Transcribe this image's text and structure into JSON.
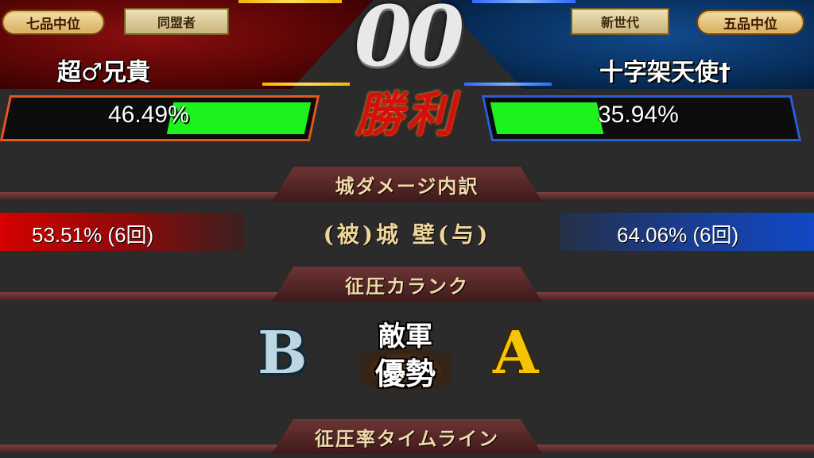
{
  "score": "00",
  "result": "勝利",
  "left": {
    "rank_badge": "七品中位",
    "guild_badge": "同盟者",
    "name": "超♂兄貴",
    "hp_percent": "46.49%",
    "hp_fill_fraction": 0.4649,
    "wall_damage": "53.51% (6回)",
    "color": "#d40000"
  },
  "right": {
    "rank_badge": "五品中位",
    "guild_badge": "新世代",
    "name": "十字架天使†",
    "hp_percent": "35.94%",
    "hp_fill_fraction": 0.3594,
    "wall_damage": "64.06% (6回)",
    "color": "#1248c6"
  },
  "sections": {
    "wall_damage_header": "城ダメージ内訳",
    "wall_label": "(被)城 壁(与)",
    "conquest_rank_header": "征圧カランク",
    "timeline_header": "征圧率タイムライン"
  },
  "conquest": {
    "left_rank": "B",
    "right_rank": "A",
    "status_line1": "敵軍",
    "status_line2": "優勢"
  },
  "colors": {
    "hp_fill": "#1df21d",
    "victory_text": "#d21010",
    "gold_accent": "#f5b400"
  }
}
